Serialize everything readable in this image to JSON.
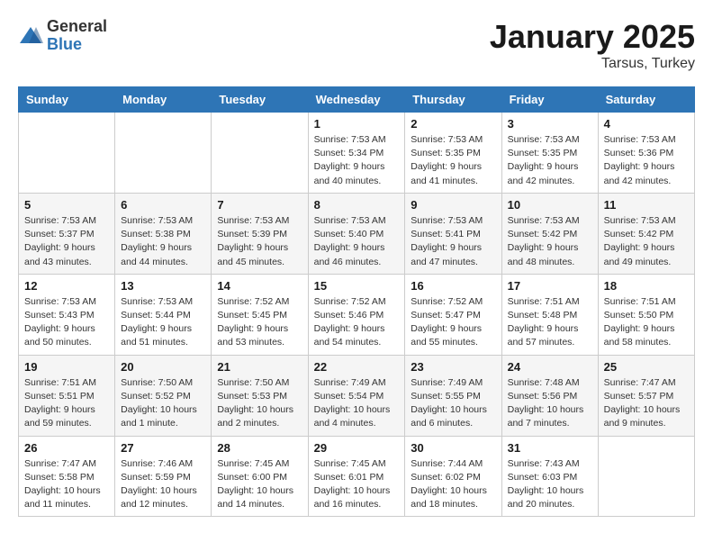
{
  "logo": {
    "general": "General",
    "blue": "Blue"
  },
  "header": {
    "month": "January 2025",
    "location": "Tarsus, Turkey"
  },
  "weekdays": [
    "Sunday",
    "Monday",
    "Tuesday",
    "Wednesday",
    "Thursday",
    "Friday",
    "Saturday"
  ],
  "weeks": [
    [
      {
        "day": "",
        "info": ""
      },
      {
        "day": "",
        "info": ""
      },
      {
        "day": "",
        "info": ""
      },
      {
        "day": "1",
        "info": "Sunrise: 7:53 AM\nSunset: 5:34 PM\nDaylight: 9 hours\nand 40 minutes."
      },
      {
        "day": "2",
        "info": "Sunrise: 7:53 AM\nSunset: 5:35 PM\nDaylight: 9 hours\nand 41 minutes."
      },
      {
        "day": "3",
        "info": "Sunrise: 7:53 AM\nSunset: 5:35 PM\nDaylight: 9 hours\nand 42 minutes."
      },
      {
        "day": "4",
        "info": "Sunrise: 7:53 AM\nSunset: 5:36 PM\nDaylight: 9 hours\nand 42 minutes."
      }
    ],
    [
      {
        "day": "5",
        "info": "Sunrise: 7:53 AM\nSunset: 5:37 PM\nDaylight: 9 hours\nand 43 minutes."
      },
      {
        "day": "6",
        "info": "Sunrise: 7:53 AM\nSunset: 5:38 PM\nDaylight: 9 hours\nand 44 minutes."
      },
      {
        "day": "7",
        "info": "Sunrise: 7:53 AM\nSunset: 5:39 PM\nDaylight: 9 hours\nand 45 minutes."
      },
      {
        "day": "8",
        "info": "Sunrise: 7:53 AM\nSunset: 5:40 PM\nDaylight: 9 hours\nand 46 minutes."
      },
      {
        "day": "9",
        "info": "Sunrise: 7:53 AM\nSunset: 5:41 PM\nDaylight: 9 hours\nand 47 minutes."
      },
      {
        "day": "10",
        "info": "Sunrise: 7:53 AM\nSunset: 5:42 PM\nDaylight: 9 hours\nand 48 minutes."
      },
      {
        "day": "11",
        "info": "Sunrise: 7:53 AM\nSunset: 5:42 PM\nDaylight: 9 hours\nand 49 minutes."
      }
    ],
    [
      {
        "day": "12",
        "info": "Sunrise: 7:53 AM\nSunset: 5:43 PM\nDaylight: 9 hours\nand 50 minutes."
      },
      {
        "day": "13",
        "info": "Sunrise: 7:53 AM\nSunset: 5:44 PM\nDaylight: 9 hours\nand 51 minutes."
      },
      {
        "day": "14",
        "info": "Sunrise: 7:52 AM\nSunset: 5:45 PM\nDaylight: 9 hours\nand 53 minutes."
      },
      {
        "day": "15",
        "info": "Sunrise: 7:52 AM\nSunset: 5:46 PM\nDaylight: 9 hours\nand 54 minutes."
      },
      {
        "day": "16",
        "info": "Sunrise: 7:52 AM\nSunset: 5:47 PM\nDaylight: 9 hours\nand 55 minutes."
      },
      {
        "day": "17",
        "info": "Sunrise: 7:51 AM\nSunset: 5:48 PM\nDaylight: 9 hours\nand 57 minutes."
      },
      {
        "day": "18",
        "info": "Sunrise: 7:51 AM\nSunset: 5:50 PM\nDaylight: 9 hours\nand 58 minutes."
      }
    ],
    [
      {
        "day": "19",
        "info": "Sunrise: 7:51 AM\nSunset: 5:51 PM\nDaylight: 9 hours\nand 59 minutes."
      },
      {
        "day": "20",
        "info": "Sunrise: 7:50 AM\nSunset: 5:52 PM\nDaylight: 10 hours\nand 1 minute."
      },
      {
        "day": "21",
        "info": "Sunrise: 7:50 AM\nSunset: 5:53 PM\nDaylight: 10 hours\nand 2 minutes."
      },
      {
        "day": "22",
        "info": "Sunrise: 7:49 AM\nSunset: 5:54 PM\nDaylight: 10 hours\nand 4 minutes."
      },
      {
        "day": "23",
        "info": "Sunrise: 7:49 AM\nSunset: 5:55 PM\nDaylight: 10 hours\nand 6 minutes."
      },
      {
        "day": "24",
        "info": "Sunrise: 7:48 AM\nSunset: 5:56 PM\nDaylight: 10 hours\nand 7 minutes."
      },
      {
        "day": "25",
        "info": "Sunrise: 7:47 AM\nSunset: 5:57 PM\nDaylight: 10 hours\nand 9 minutes."
      }
    ],
    [
      {
        "day": "26",
        "info": "Sunrise: 7:47 AM\nSunset: 5:58 PM\nDaylight: 10 hours\nand 11 minutes."
      },
      {
        "day": "27",
        "info": "Sunrise: 7:46 AM\nSunset: 5:59 PM\nDaylight: 10 hours\nand 12 minutes."
      },
      {
        "day": "28",
        "info": "Sunrise: 7:45 AM\nSunset: 6:00 PM\nDaylight: 10 hours\nand 14 minutes."
      },
      {
        "day": "29",
        "info": "Sunrise: 7:45 AM\nSunset: 6:01 PM\nDaylight: 10 hours\nand 16 minutes."
      },
      {
        "day": "30",
        "info": "Sunrise: 7:44 AM\nSunset: 6:02 PM\nDaylight: 10 hours\nand 18 minutes."
      },
      {
        "day": "31",
        "info": "Sunrise: 7:43 AM\nSunset: 6:03 PM\nDaylight: 10 hours\nand 20 minutes."
      },
      {
        "day": "",
        "info": ""
      }
    ]
  ]
}
